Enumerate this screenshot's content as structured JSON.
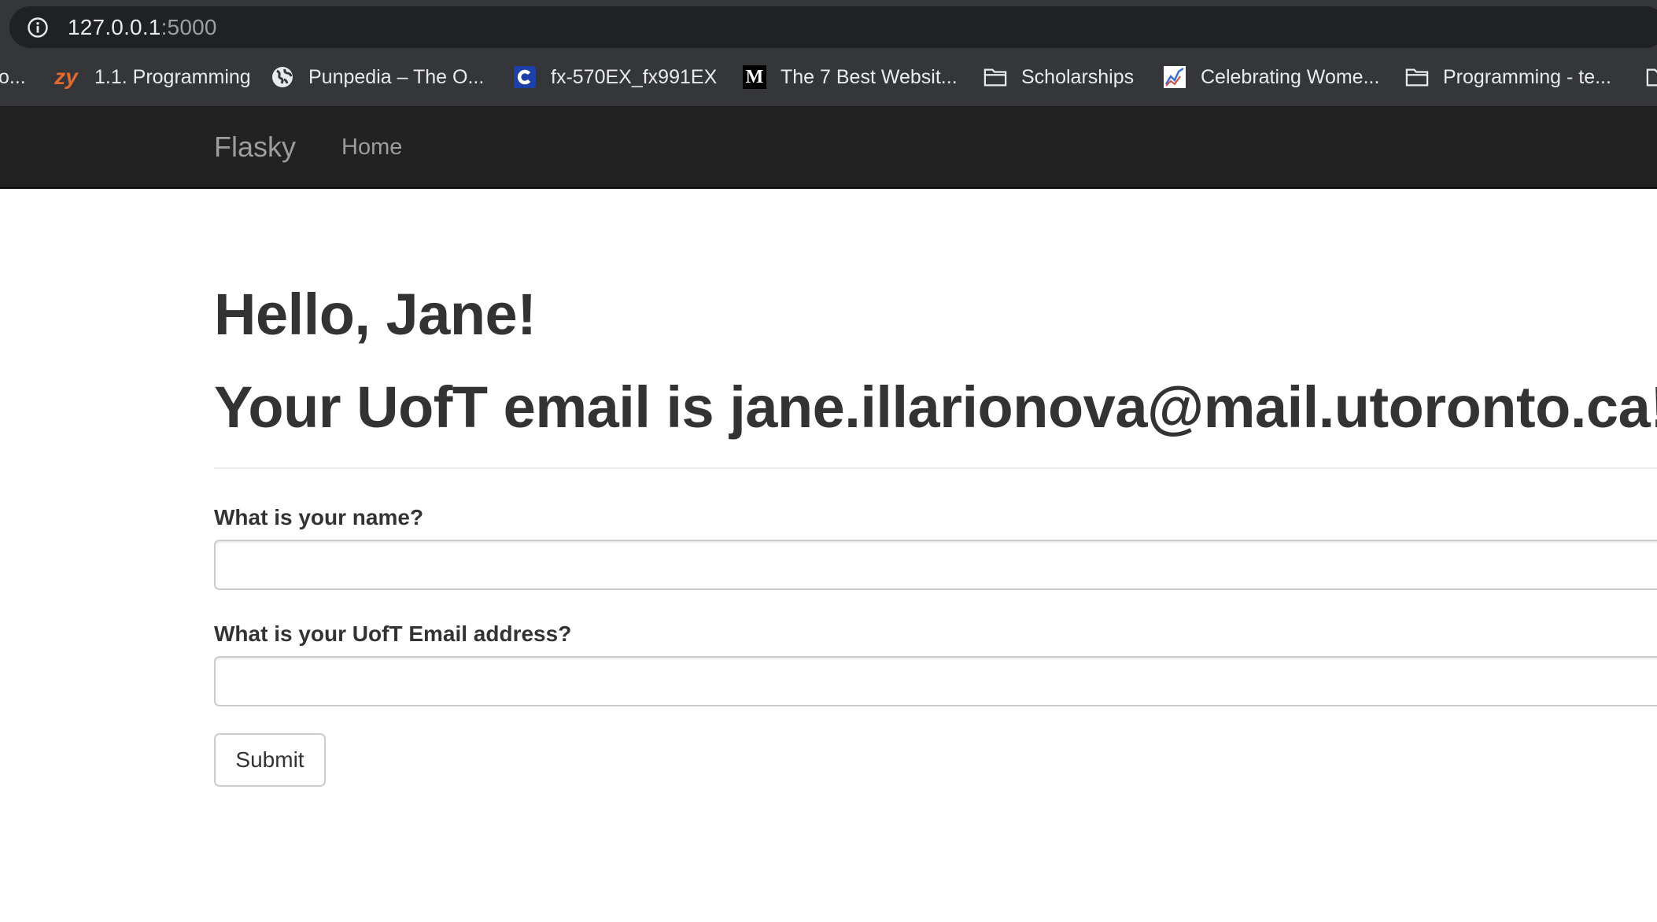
{
  "browser": {
    "url_host": "127.0.0.1",
    "url_port": ":5000",
    "bookmarks": [
      {
        "label": "o...",
        "icon": "none"
      },
      {
        "label": "1.1. Programming",
        "icon": "zybooks-icon",
        "icon_text": "zy"
      },
      {
        "label": "Punpedia – The O...",
        "icon": "globe-icon"
      },
      {
        "label": "fx-570EX_fx991EX",
        "icon": "casio-c-icon"
      },
      {
        "label": "The 7 Best Websit...",
        "icon": "medium-m-icon"
      },
      {
        "label": "Scholarships",
        "icon": "folder-icon"
      },
      {
        "label": "Celebrating Wome...",
        "icon": "chart-icon"
      },
      {
        "label": "Programming - te...",
        "icon": "folder-icon"
      }
    ]
  },
  "navbar": {
    "brand": "Flasky",
    "home": "Home"
  },
  "page": {
    "greeting": "Hello, Jane!",
    "email_line": "Your UofT email is jane.illarionova@mail.utoronto.ca!",
    "name_label": "What is your name?",
    "name_value": "",
    "email_label": "What is your UofT Email address?",
    "email_value": "",
    "submit_label": "Submit"
  },
  "colors": {
    "navbar_bg": "#222222",
    "navbar_text": "#9d9d9d",
    "chrome_bg": "#35363a",
    "text": "#333333"
  }
}
